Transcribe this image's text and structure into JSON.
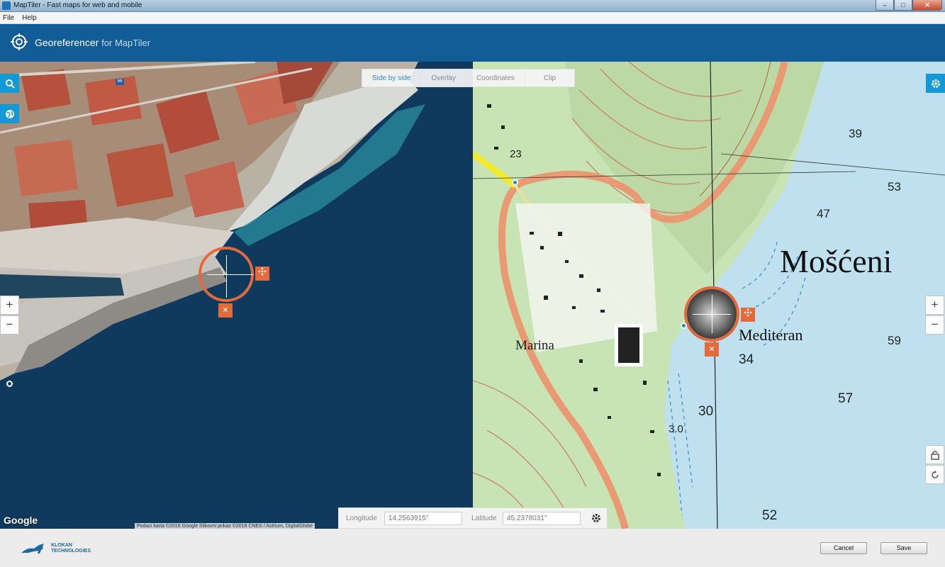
{
  "window": {
    "title": "MapTiler - Fast maps for web and mobile",
    "controls": [
      "–",
      "□",
      "✕"
    ]
  },
  "menu": [
    "File",
    "Help"
  ],
  "header": {
    "product": "Georeferencer",
    "suffix": "for MapTiler"
  },
  "view_tabs": [
    {
      "label": "Side by side",
      "active": true
    },
    {
      "label": "Overlay",
      "active": false
    },
    {
      "label": "Coordinates",
      "active": false
    },
    {
      "label": "Clip",
      "active": false
    }
  ],
  "left_map": {
    "source_logo": "Google",
    "road_label": "66",
    "attribution": "Podaci karta ©2016 Google Slikovni prikaz ©2016 CNES / Astrium, DigitalGlobe",
    "zoom_in": "+",
    "zoom_out": "−",
    "icons": [
      "search-icon",
      "globe-icon"
    ]
  },
  "right_map": {
    "place_labels": {
      "main": "Mošćeni",
      "mediteran": "Mediteran",
      "marina": "Marina"
    },
    "spot_heights": [
      "39",
      "53",
      "47",
      "59",
      "34",
      "57",
      "30",
      "3.0",
      "52",
      "23"
    ],
    "zoom_in": "+",
    "zoom_out": "−",
    "icons": [
      "settings-icon",
      "lock-icon",
      "rotate-icon"
    ]
  },
  "coordinates": {
    "longitude_label": "Longitude",
    "longitude_value": "14.2563915°",
    "latitude_label": "Latitude",
    "latitude_value": "45.2378031°"
  },
  "markers": {
    "remove_glyph": "✕"
  },
  "footer": {
    "company_line1": "KLOKAN",
    "company_line2": "TECHNOLOGIES",
    "cancel": "Cancel",
    "save": "Save"
  },
  "colors": {
    "header": "#125d97",
    "accent": "#139ad6",
    "marker": "#e46a3c",
    "sea": "#0f3a5e",
    "topo_land": "#c8e3b4",
    "topo_sea": "#bfe1ef"
  }
}
